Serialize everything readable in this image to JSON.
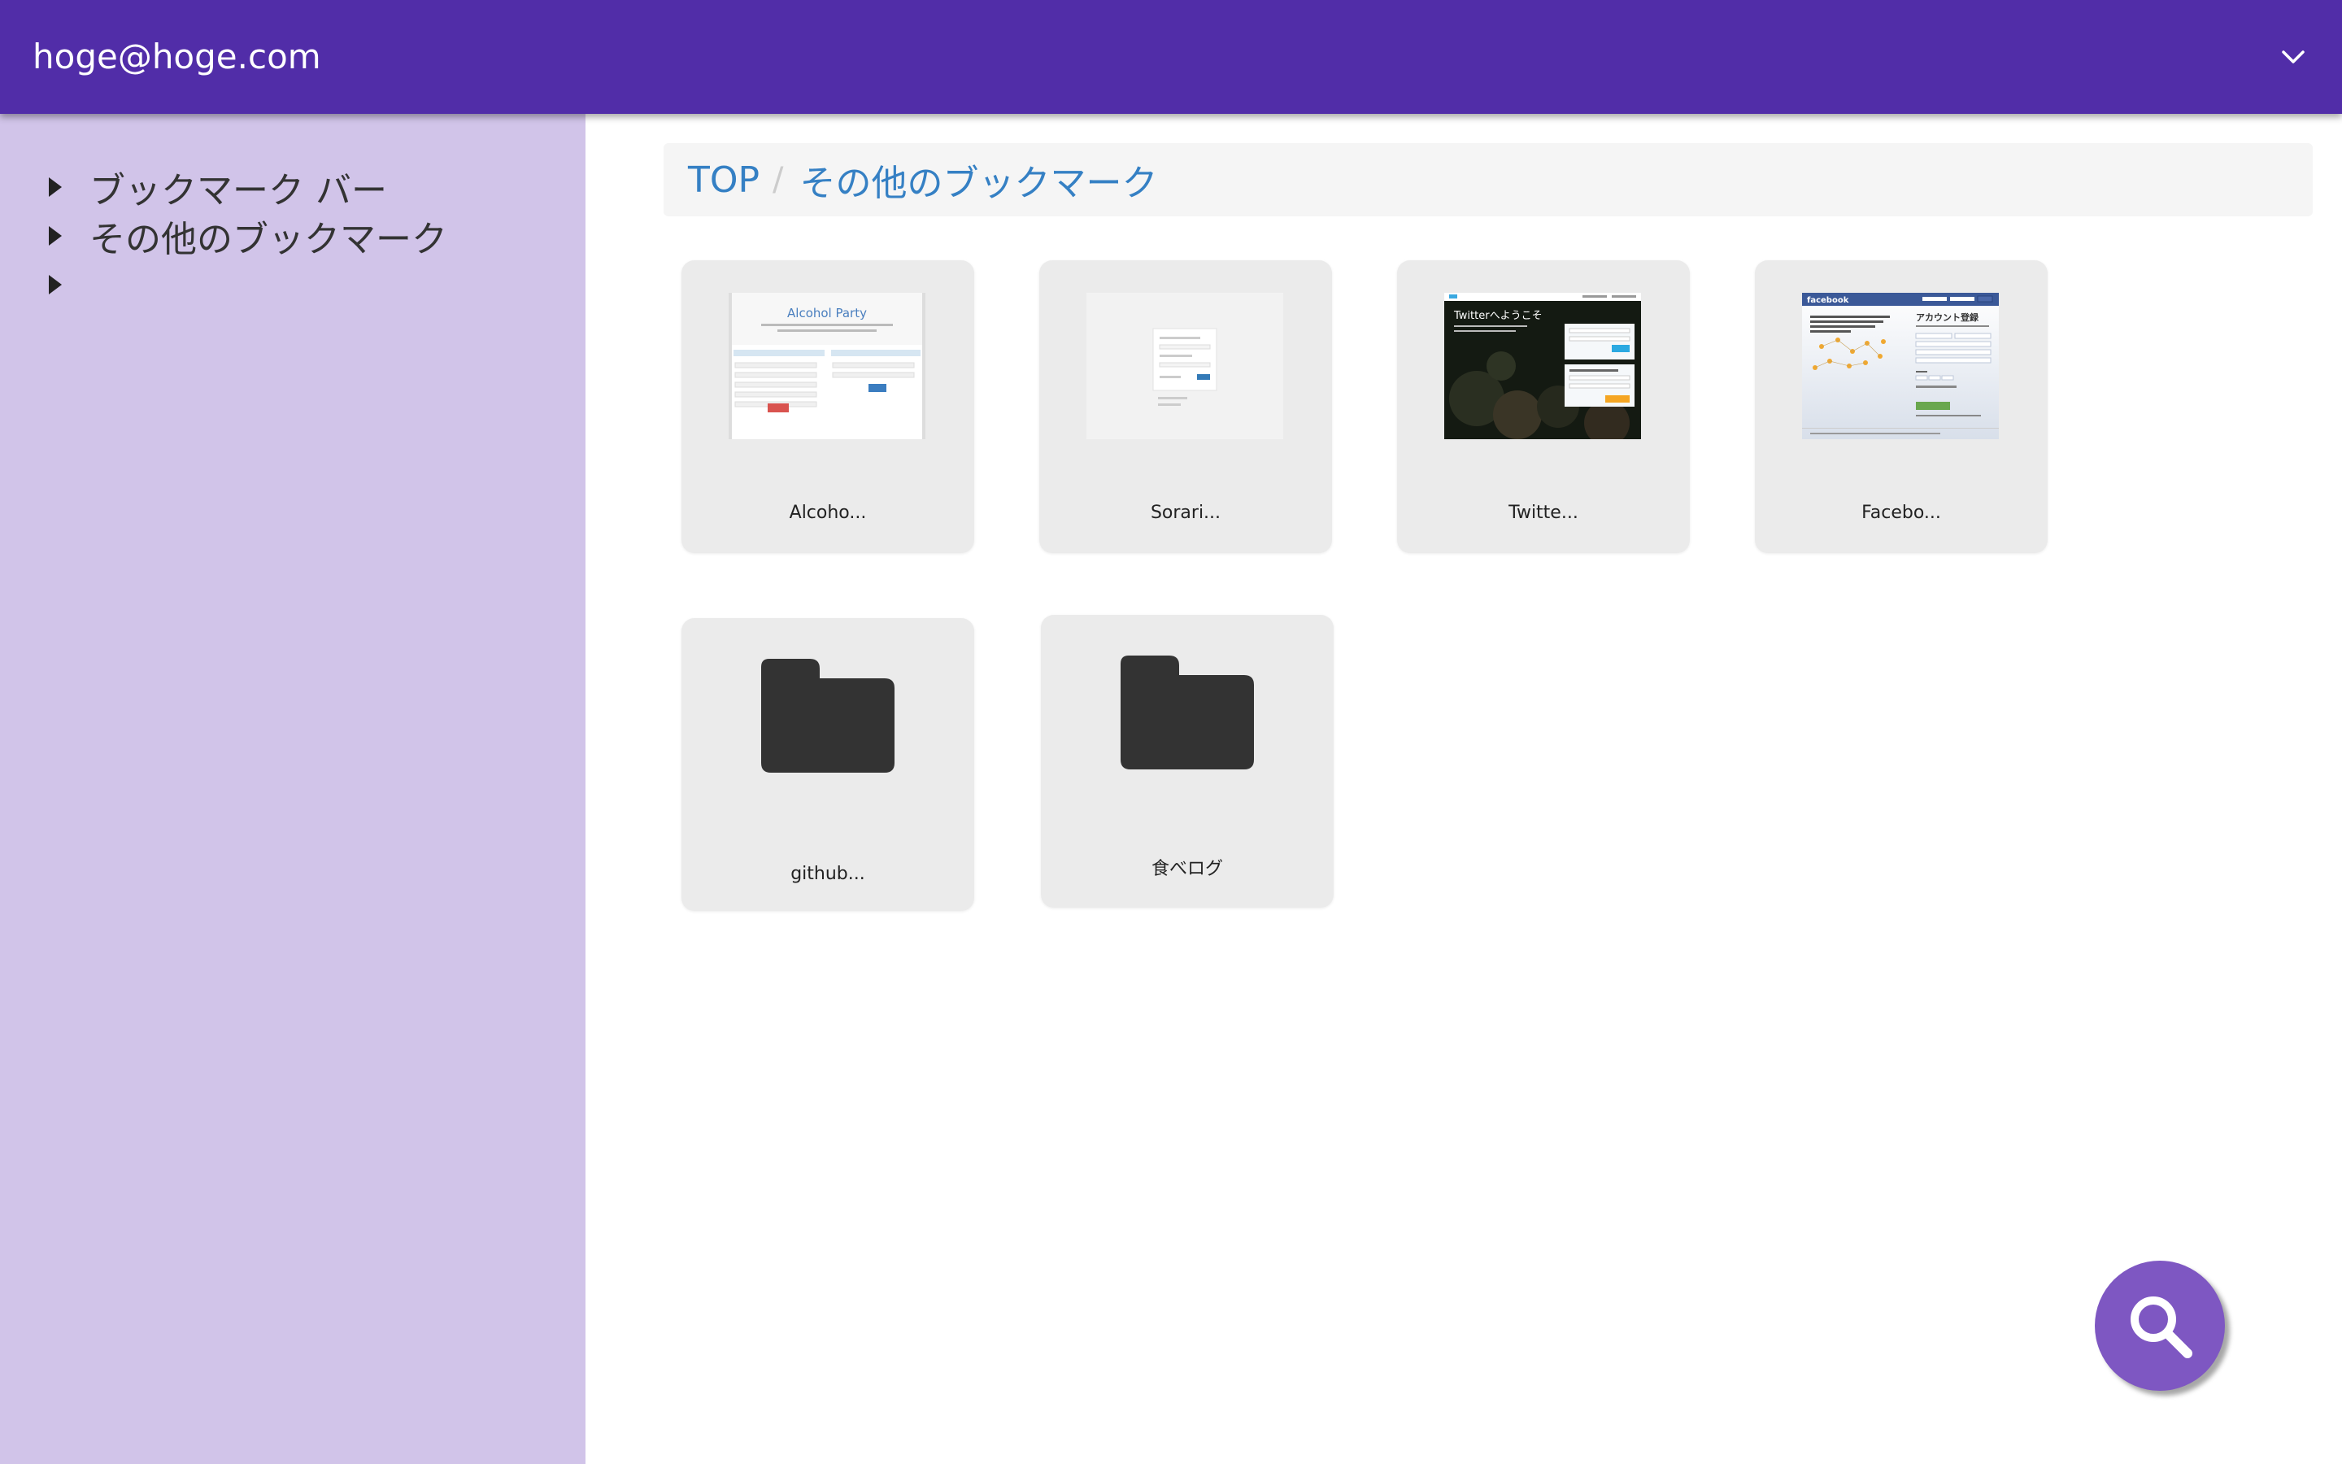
{
  "header": {
    "account_email": "hoge@hoge.com",
    "menu_icon": "chevron-down-icon",
    "background_color": "#512da8"
  },
  "sidebar": {
    "background_color": "#d1c4e9",
    "items": [
      {
        "label": "ブックマーク バー",
        "icon": "caret-right-icon"
      },
      {
        "label": "その他のブックマーク",
        "icon": "caret-right-icon"
      },
      {
        "label": "",
        "icon": "caret-right-icon"
      }
    ]
  },
  "breadcrumb": {
    "items": [
      {
        "label": "TOP"
      },
      {
        "label": "その他のブックマーク"
      }
    ],
    "separator": "/"
  },
  "bookmarks": [
    {
      "title": "Alcoho...",
      "kind": "page",
      "thumb_heading": "Alcohol Party"
    },
    {
      "title": "Sorari...",
      "kind": "page"
    },
    {
      "title": "Twitte...",
      "kind": "page",
      "thumb_heading": "Twitterへようこそ"
    },
    {
      "title": "Facebo...",
      "kind": "page",
      "thumb_heading": "facebook",
      "thumb_subheading": "アカウント登録"
    },
    {
      "title": "github...",
      "kind": "folder",
      "icon": "folder-icon"
    },
    {
      "title": "食べログ",
      "kind": "folder",
      "icon": "folder-icon"
    }
  ],
  "fab": {
    "icon": "search-icon",
    "color": "#7e57c2"
  }
}
